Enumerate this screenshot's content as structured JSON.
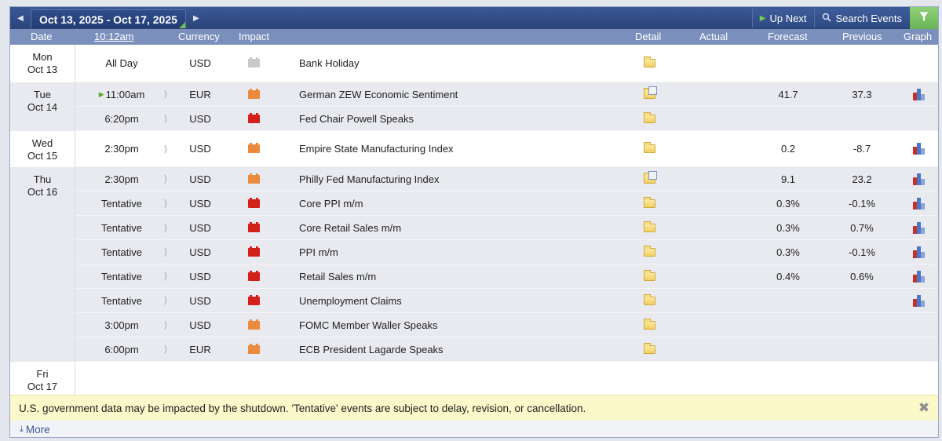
{
  "toolbar": {
    "date_range": "Oct 13, 2025 - Oct 17, 2025",
    "up_next_label": "Up Next",
    "search_label": "Search Events"
  },
  "columns": {
    "date": "Date",
    "time": "10:12am",
    "currency": "Currency",
    "impact": "Impact",
    "detail": "Detail",
    "actual": "Actual",
    "forecast": "Forecast",
    "previous": "Previous",
    "graph": "Graph"
  },
  "colors": {
    "impact_high": "#d3201a",
    "impact_medium": "#e98a3d",
    "impact_holiday": "#c9c9c9",
    "header_bar": "#2b4479",
    "column_bar": "#7b8fbd",
    "notice_bg": "#fbf8c9"
  },
  "days": [
    {
      "weekday": "Mon",
      "date": "Oct 13"
    },
    {
      "weekday": "Tue",
      "date": "Oct 14"
    },
    {
      "weekday": "Wed",
      "date": "Oct 15"
    },
    {
      "weekday": "Thu",
      "date": "Oct 16"
    },
    {
      "weekday": "Fri",
      "date": "Oct 17"
    }
  ],
  "events": [
    {
      "time": "All Day",
      "currency": "USD",
      "impact": "holiday",
      "event": "Bank Holiday",
      "detail_icon": "folder",
      "actual": "",
      "forecast": "",
      "previous": "",
      "graph": false
    },
    {
      "time": "11:00am",
      "currency": "EUR",
      "impact": "medium",
      "event": "German ZEW Economic Sentiment",
      "detail_icon": "folder-doc",
      "actual": "",
      "forecast": "41.7",
      "previous": "37.3",
      "graph": true
    },
    {
      "time": "6:20pm",
      "currency": "USD",
      "impact": "high",
      "event": "Fed Chair Powell Speaks",
      "detail_icon": "folder",
      "actual": "",
      "forecast": "",
      "previous": "",
      "graph": false
    },
    {
      "time": "2:30pm",
      "currency": "USD",
      "impact": "medium",
      "event": "Empire State Manufacturing Index",
      "detail_icon": "folder",
      "actual": "",
      "forecast": "0.2",
      "previous": "-8.7",
      "graph": true
    },
    {
      "time": "2:30pm",
      "currency": "USD",
      "impact": "medium",
      "event": "Philly Fed Manufacturing Index",
      "detail_icon": "folder-doc",
      "actual": "",
      "forecast": "9.1",
      "previous": "23.2",
      "graph": true
    },
    {
      "time": "Tentative",
      "currency": "USD",
      "impact": "high",
      "event": "Core PPI m/m",
      "detail_icon": "folder",
      "actual": "",
      "forecast": "0.3%",
      "previous": "-0.1%",
      "graph": true
    },
    {
      "time": "Tentative",
      "currency": "USD",
      "impact": "high",
      "event": "Core Retail Sales m/m",
      "detail_icon": "folder",
      "actual": "",
      "forecast": "0.3%",
      "previous": "0.7%",
      "graph": true
    },
    {
      "time": "Tentative",
      "currency": "USD",
      "impact": "high",
      "event": "PPI m/m",
      "detail_icon": "folder",
      "actual": "",
      "forecast": "0.3%",
      "previous": "-0.1%",
      "graph": true
    },
    {
      "time": "Tentative",
      "currency": "USD",
      "impact": "high",
      "event": "Retail Sales m/m",
      "detail_icon": "folder",
      "actual": "",
      "forecast": "0.4%",
      "previous": "0.6%",
      "graph": true
    },
    {
      "time": "Tentative",
      "currency": "USD",
      "impact": "high",
      "event": "Unemployment Claims",
      "detail_icon": "folder",
      "actual": "",
      "forecast": "",
      "previous": "",
      "graph": true
    },
    {
      "time": "3:00pm",
      "currency": "USD",
      "impact": "medium",
      "event": "FOMC Member Waller Speaks",
      "detail_icon": "folder",
      "actual": "",
      "forecast": "",
      "previous": "",
      "graph": false
    },
    {
      "time": "6:00pm",
      "currency": "EUR",
      "impact": "medium",
      "event": "ECB President Lagarde Speaks",
      "detail_icon": "folder",
      "actual": "",
      "forecast": "",
      "previous": "",
      "graph": false
    }
  ],
  "notice": "U.S. government data may be impacted by the shutdown. 'Tentative' events are subject to delay, revision, or cancellation.",
  "more_label": "More"
}
